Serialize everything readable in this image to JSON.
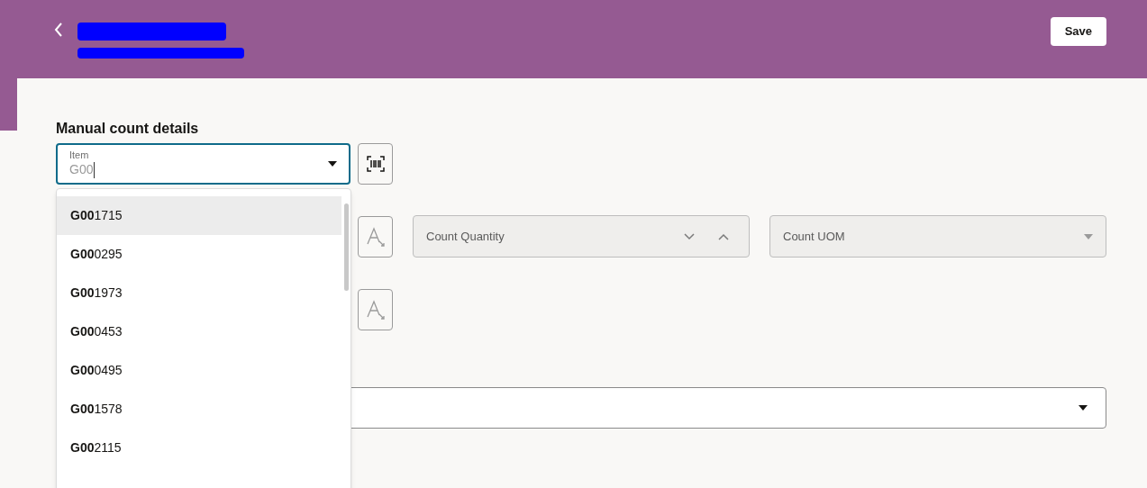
{
  "header": {
    "save_button": "Save"
  },
  "form": {
    "title": "Manual count details",
    "item_field": {
      "label": "Item",
      "value": "G00"
    },
    "count_quantity": {
      "placeholder": "Count Quantity"
    },
    "count_uom": {
      "placeholder": "Count UOM"
    }
  },
  "dropdown": {
    "options": [
      {
        "label": "**G00**1715",
        "selected": true
      },
      {
        "label": "**G00**0295",
        "selected": false
      },
      {
        "label": "**G00**1973",
        "selected": false
      },
      {
        "label": "**G00**0453",
        "selected": false
      },
      {
        "label": "**G00**0495",
        "selected": false
      },
      {
        "label": "**G00**1578",
        "selected": false
      },
      {
        "label": "**G00**2115",
        "selected": false
      }
    ]
  }
}
